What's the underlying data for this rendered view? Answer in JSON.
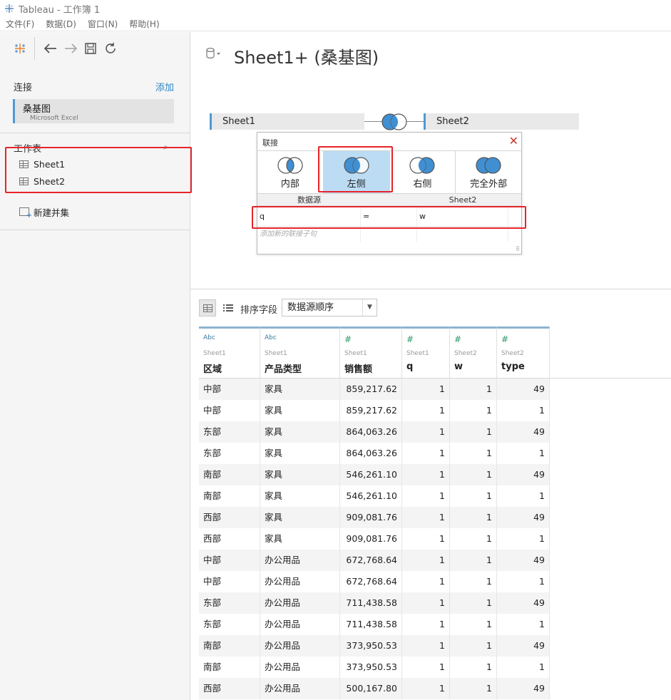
{
  "window": {
    "title": "Tableau - 工作簿 1"
  },
  "menu": [
    "文件(F)",
    "数据(D)",
    "窗口(N)",
    "帮助(H)"
  ],
  "left": {
    "connections_label": "连接",
    "add_label": "添加",
    "connection": {
      "name": "桑基图",
      "type": "Microsoft Excel"
    },
    "sheets_label": "工作表",
    "sheets": [
      "Sheet1",
      "Sheet2"
    ],
    "new_union": "新建并集"
  },
  "datasource": {
    "title": "Sheet1+ (桑基图)",
    "left_table": "Sheet1",
    "right_table": "Sheet2"
  },
  "join": {
    "header": "联接",
    "types": [
      {
        "label": "内部",
        "selected": false
      },
      {
        "label": "左侧",
        "selected": true
      },
      {
        "label": "右侧",
        "selected": false
      },
      {
        "label": "完全外部",
        "selected": false
      }
    ],
    "col_left": "数据源",
    "col_right": "Sheet2",
    "clause": {
      "left": "q",
      "op": "=",
      "right": "w"
    },
    "add_clause": "添加新的联接子句"
  },
  "grid_toolbar": {
    "sort_label": "排序字段",
    "sort_value": "数据源顺序"
  },
  "columns": [
    {
      "type": "Abc",
      "source": "Sheet1",
      "name": "区域"
    },
    {
      "type": "Abc",
      "source": "Sheet1",
      "name": "产品类型"
    },
    {
      "type": "#",
      "source": "Sheet1",
      "name": "销售额"
    },
    {
      "type": "#",
      "source": "Sheet1",
      "name": "q"
    },
    {
      "type": "#",
      "source": "Sheet2",
      "name": "w"
    },
    {
      "type": "#",
      "source": "Sheet2",
      "name": "type"
    }
  ],
  "rows": [
    [
      "中部",
      "家具",
      "859,217.62",
      "1",
      "1",
      "49"
    ],
    [
      "中部",
      "家具",
      "859,217.62",
      "1",
      "1",
      "1"
    ],
    [
      "东部",
      "家具",
      "864,063.26",
      "1",
      "1",
      "49"
    ],
    [
      "东部",
      "家具",
      "864,063.26",
      "1",
      "1",
      "1"
    ],
    [
      "南部",
      "家具",
      "546,261.10",
      "1",
      "1",
      "49"
    ],
    [
      "南部",
      "家具",
      "546,261.10",
      "1",
      "1",
      "1"
    ],
    [
      "西部",
      "家具",
      "909,081.76",
      "1",
      "1",
      "49"
    ],
    [
      "西部",
      "家具",
      "909,081.76",
      "1",
      "1",
      "1"
    ],
    [
      "中部",
      "办公用品",
      "672,768.64",
      "1",
      "1",
      "49"
    ],
    [
      "中部",
      "办公用品",
      "672,768.64",
      "1",
      "1",
      "1"
    ],
    [
      "东部",
      "办公用品",
      "711,438.58",
      "1",
      "1",
      "49"
    ],
    [
      "东部",
      "办公用品",
      "711,438.58",
      "1",
      "1",
      "1"
    ],
    [
      "南部",
      "办公用品",
      "373,950.53",
      "1",
      "1",
      "49"
    ],
    [
      "南部",
      "办公用品",
      "373,950.53",
      "1",
      "1",
      "1"
    ],
    [
      "西部",
      "办公用品",
      "500,167.80",
      "1",
      "1",
      "49"
    ]
  ]
}
